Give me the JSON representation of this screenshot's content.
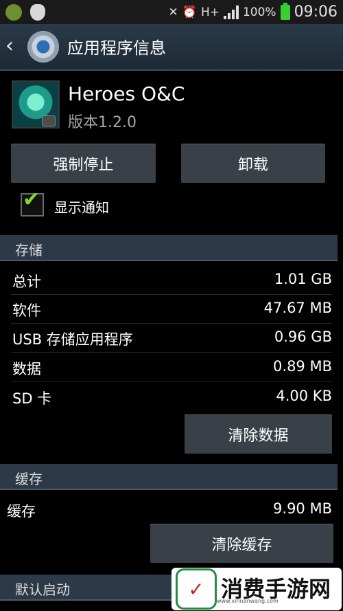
{
  "status_bar": {
    "battery": "100%",
    "time": "09:06",
    "network": "H+"
  },
  "title_bar": {
    "title": "应用程序信息",
    "back_icon": "chevron-left",
    "settings_icon": "gear"
  },
  "app": {
    "name": "Heroes O&C",
    "version": "版本1.2.0"
  },
  "buttons": {
    "force_stop": "强制停止",
    "uninstall": "卸载",
    "clear_data": "清除数据",
    "clear_cache": "清除缓存"
  },
  "notification_checkbox": {
    "label": "显示通知",
    "checked": true
  },
  "storage": {
    "header": "存储",
    "rows": [
      {
        "label": "总计",
        "value": "1.01 GB"
      },
      {
        "label": "软件",
        "value": "47.67 MB"
      },
      {
        "label": "USB 存储应用程序",
        "value": "0.96 GB"
      },
      {
        "label": "数据",
        "value": "0.89 MB"
      },
      {
        "label": "SD 卡",
        "value": "4.00 KB"
      }
    ]
  },
  "cache": {
    "header": "缓存",
    "label": "缓存",
    "value": "9.90 MB"
  },
  "default_launch": {
    "header": "默认启动"
  },
  "watermark": {
    "text": "消费手游网",
    "url": "www.xinnanwang.com"
  },
  "colors": {
    "accent_green": "#7ddc2a",
    "section_bg": "#2c3a47",
    "button_bg": "#3a4048"
  }
}
